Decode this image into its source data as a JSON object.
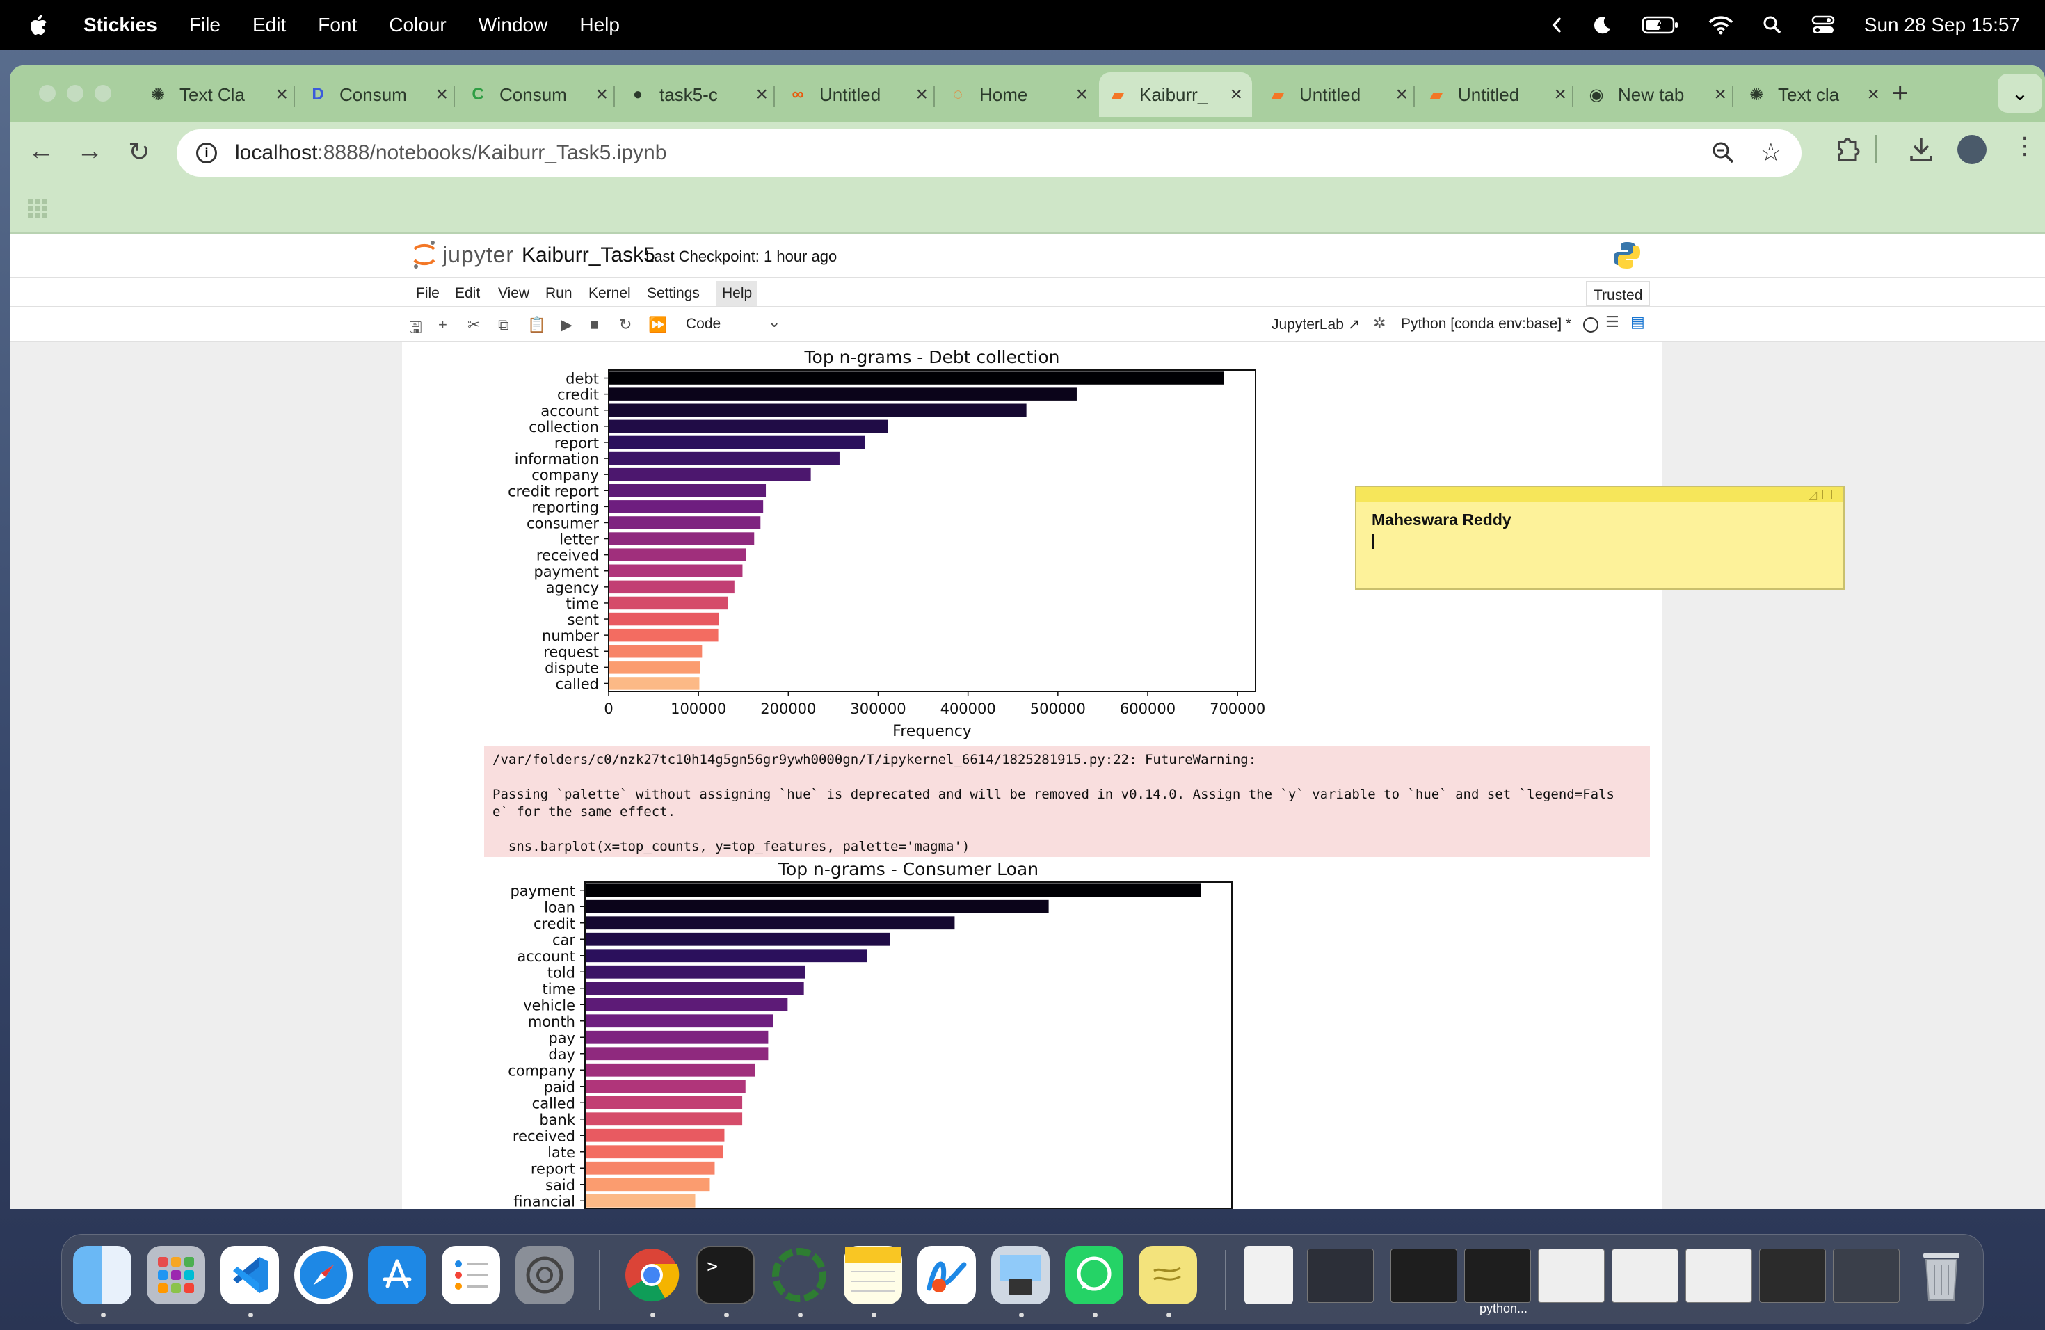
{
  "menubar": {
    "app_name": "Stickies",
    "menus": [
      "File",
      "Edit",
      "Font",
      "Colour",
      "Window",
      "Help"
    ],
    "datetime": "Sun 28 Sep  15:57"
  },
  "browser": {
    "tabs": [
      {
        "title": "Text Cla",
        "icon": "chatgpt-icon"
      },
      {
        "title": "Consum",
        "icon": "d-logo-icon"
      },
      {
        "title": "Consum",
        "icon": "c-logo-icon"
      },
      {
        "title": "task5-c",
        "icon": "github-icon"
      },
      {
        "title": "Untitled",
        "icon": "colab-icon"
      },
      {
        "title": "Home",
        "icon": "jupyter-icon"
      },
      {
        "title": "Kaiburr_",
        "icon": "notebook-icon"
      },
      {
        "title": "Untitled",
        "icon": "notebook-icon"
      },
      {
        "title": "Untitled",
        "icon": "notebook-icon"
      },
      {
        "title": "New tab",
        "icon": "chrome-icon"
      },
      {
        "title": "Text cla",
        "icon": "chatgpt-icon"
      }
    ],
    "active_tab": 6,
    "url_host": "localhost",
    "url_path": ":8888/notebooks/Kaiburr_Task5.ipynb"
  },
  "jupyter": {
    "logo_text": "jupyter",
    "notebook_name": "Kaiburr_Task5",
    "checkpoint": "Last Checkpoint: 1 hour ago",
    "menus": [
      "File",
      "Edit",
      "View",
      "Run",
      "Kernel",
      "Settings",
      "Help"
    ],
    "trusted": "Trusted",
    "cell_type": "Code",
    "jupyterlab_link": "JupyterLab",
    "kernel": "Python [conda env:base] *"
  },
  "warning": {
    "line1": "/var/folders/c0/nzk27tc10h14g5gn56gr9ywh0000gn/T/ipykernel_6614/1825281915.py:22: FutureWarning:",
    "line2": "Passing `palette` without assigning `hue` is deprecated and will be removed in v0.14.0. Assign the `y` variable to `hue` and set `legend=Fals",
    "line3": "e` for the same effect.",
    "line4": "  sns.barplot(x=top_counts, y=top_features, palette='magma')"
  },
  "sticky": {
    "text": "Maheswara Reddy",
    "color": "#fdf29a"
  },
  "chart_data": [
    {
      "type": "bar",
      "orientation": "horizontal",
      "title": "Top n-grams - Debt collection",
      "xlabel": "Frequency",
      "ylabel": "",
      "categories": [
        "debt",
        "credit",
        "account",
        "collection",
        "report",
        "information",
        "company",
        "credit report",
        "reporting",
        "consumer",
        "letter",
        "received",
        "payment",
        "agency",
        "time",
        "sent",
        "number",
        "request",
        "dispute",
        "called"
      ],
      "values": [
        685000,
        521000,
        465000,
        311000,
        285000,
        257000,
        225000,
        175000,
        172000,
        169000,
        162000,
        153000,
        149000,
        140000,
        133000,
        123000,
        122000,
        104000,
        102000,
        101000
      ],
      "xticks": [
        0,
        100000,
        200000,
        300000,
        400000,
        500000,
        600000,
        700000
      ],
      "xlim": [
        0,
        720000
      ],
      "palette": "magma"
    },
    {
      "type": "bar",
      "orientation": "horizontal",
      "title": "Top n-grams - Consumer Loan",
      "xlabel": "",
      "ylabel": "",
      "categories": [
        "payment",
        "loan",
        "credit",
        "car",
        "account",
        "told",
        "time",
        "vehicle",
        "month",
        "pay",
        "day",
        "company",
        "paid",
        "called",
        "bank",
        "received",
        "late",
        "report",
        "said",
        "financial"
      ],
      "values": [
        19000,
        14300,
        11400,
        9400,
        8700,
        6800,
        6750,
        6250,
        5800,
        5650,
        5650,
        5250,
        4950,
        4850,
        4850,
        4300,
        4250,
        4000,
        3850,
        3400
      ],
      "palette": "magma"
    }
  ],
  "dock": {
    "apps": [
      "finder-icon",
      "launchpad-icon",
      "vscode-icon",
      "safari-icon",
      "app-store-icon",
      "reminders-icon",
      "system-settings-icon",
      "chrome-icon",
      "terminal-icon",
      "activity-icon",
      "notes-icon",
      "freeform-icon",
      "preview-icon",
      "whatsapp-icon",
      "stickies-icon"
    ],
    "window_label": "python..."
  }
}
